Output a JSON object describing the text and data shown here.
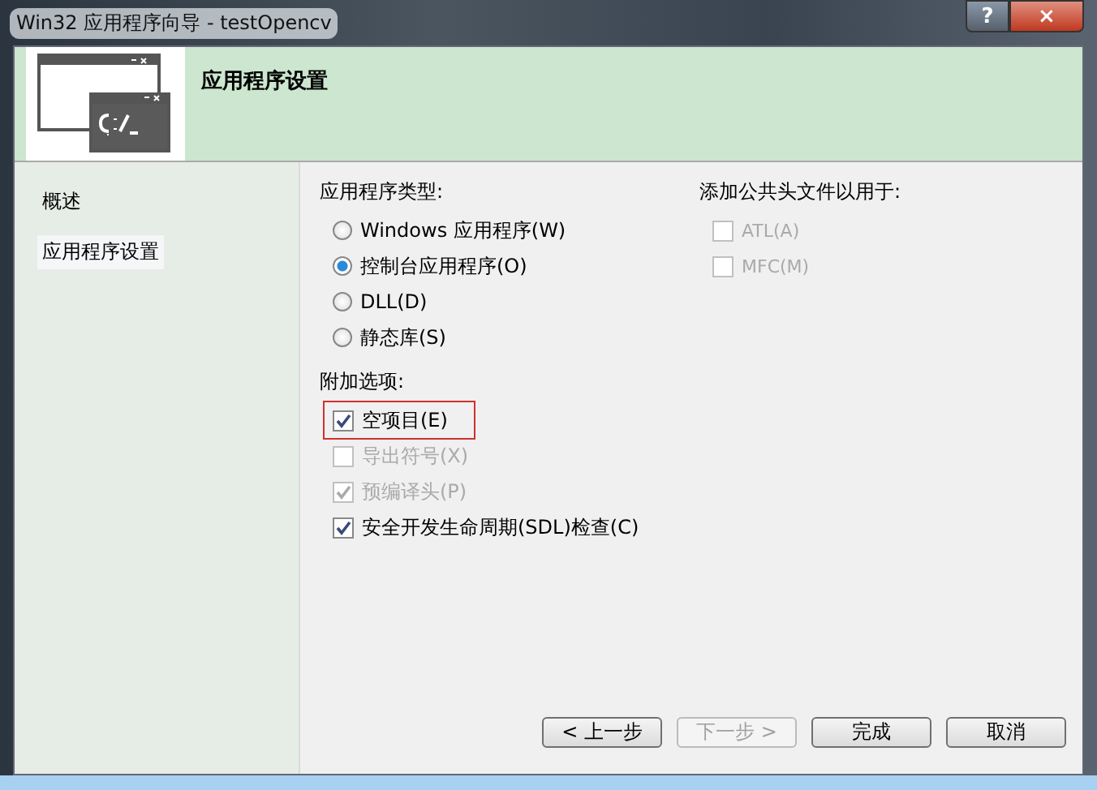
{
  "window": {
    "title": "Win32 应用程序向导 - testOpencv",
    "help_button": "?",
    "close_button": "×"
  },
  "header": {
    "title": "应用程序设置"
  },
  "sidebar": {
    "items": [
      {
        "label": "概述",
        "selected": false
      },
      {
        "label": "应用程序设置",
        "selected": true
      }
    ]
  },
  "application_type": {
    "label": "应用程序类型:",
    "options": [
      {
        "label": "Windows 应用程序(W)",
        "selected": false
      },
      {
        "label": "控制台应用程序(O)",
        "selected": true
      },
      {
        "label": "DLL(D)",
        "selected": false
      },
      {
        "label": "静态库(S)",
        "selected": false
      }
    ]
  },
  "additional_options": {
    "label": "附加选项:",
    "options": [
      {
        "label": "空项目(E)",
        "checked": true,
        "disabled": false,
        "highlighted": true
      },
      {
        "label": "导出符号(X)",
        "checked": false,
        "disabled": true,
        "highlighted": false
      },
      {
        "label": "预编译头(P)",
        "checked": true,
        "disabled": true,
        "highlighted": false
      },
      {
        "label": "安全开发生命周期(SDL)检查(C)",
        "checked": true,
        "disabled": false,
        "highlighted": false
      }
    ]
  },
  "common_headers": {
    "label": "添加公共头文件以用于:",
    "options": [
      {
        "label": "ATL(A)",
        "checked": false,
        "disabled": true
      },
      {
        "label": "MFC(M)",
        "checked": false,
        "disabled": true
      }
    ]
  },
  "buttons": [
    {
      "label": "< 上一步",
      "disabled": false
    },
    {
      "label": "下一步 >",
      "disabled": true
    },
    {
      "label": "完成",
      "disabled": false
    },
    {
      "label": "取消",
      "disabled": false
    }
  ]
}
